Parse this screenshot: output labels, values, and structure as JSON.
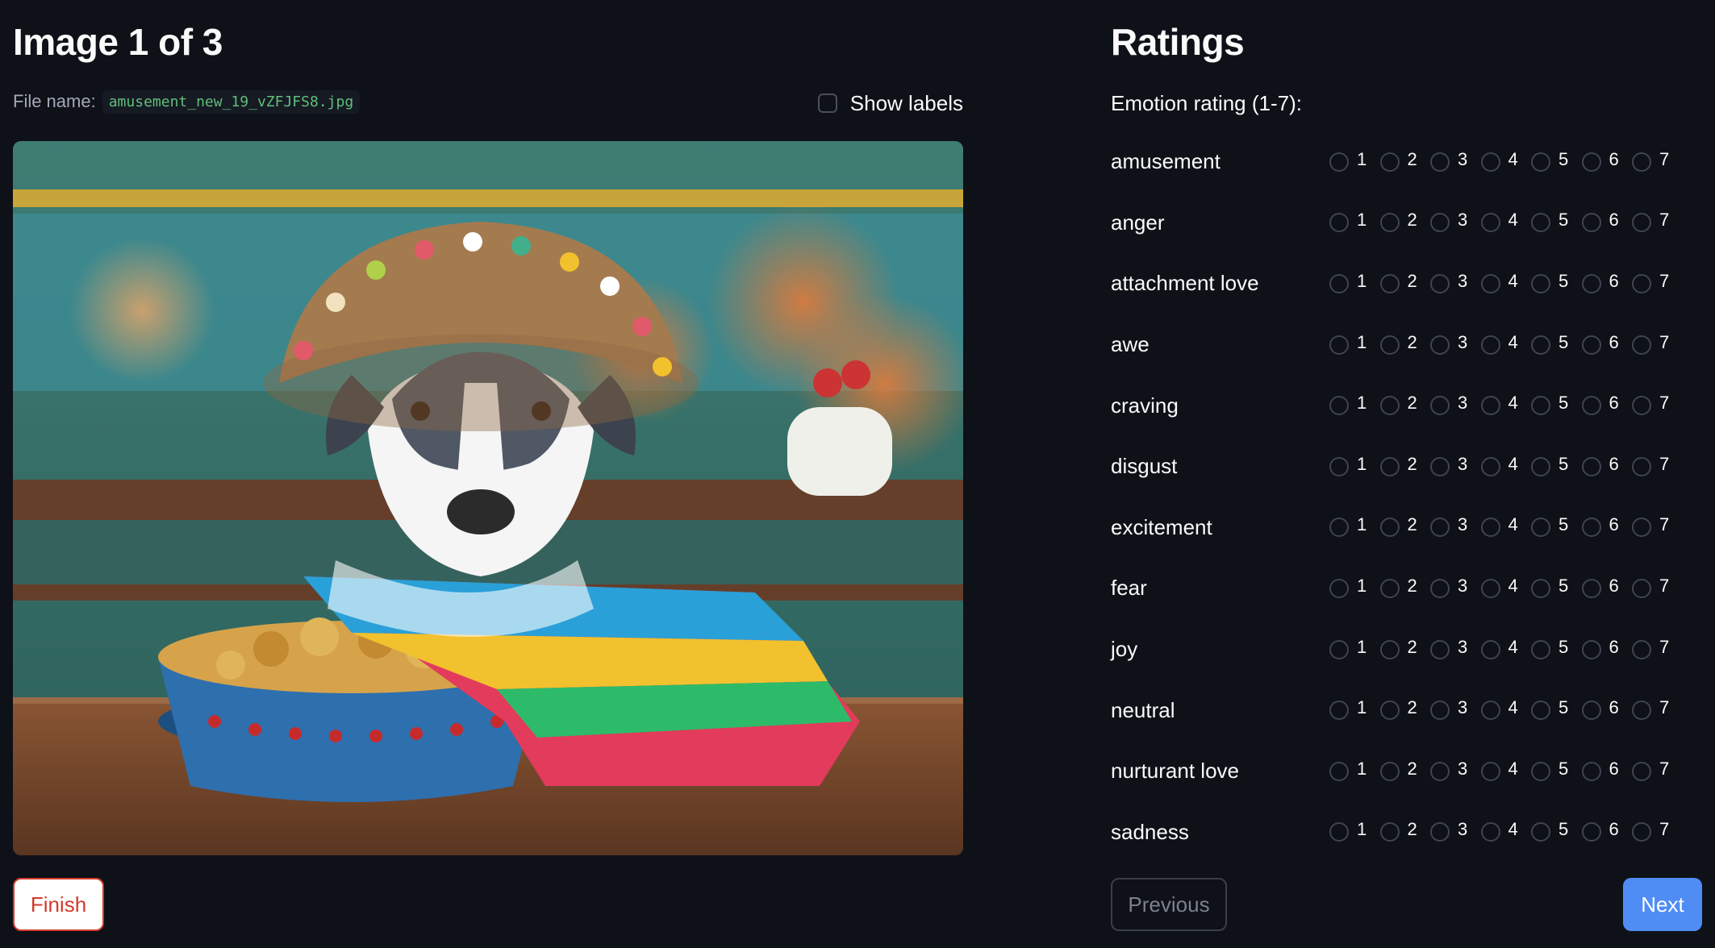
{
  "left": {
    "title": "Image 1 of 3",
    "file_label": "File name:",
    "file_name": "amusement_new_19_vZFJFS8.jpg",
    "show_labels_label": "Show labels",
    "show_labels_checked": false,
    "finish_label": "Finish"
  },
  "right": {
    "title": "Ratings",
    "subtitle": "Emotion rating (1-7):",
    "scale": [
      "1",
      "2",
      "3",
      "4",
      "5",
      "6",
      "7"
    ],
    "emotions": [
      "amusement",
      "anger",
      "attachment love",
      "awe",
      "craving",
      "disgust",
      "excitement",
      "fear",
      "joy",
      "neutral",
      "nurturant love",
      "sadness"
    ],
    "previous_label": "Previous",
    "next_label": "Next"
  },
  "colors": {
    "background": "#0e1117",
    "accent": "#4f8df5",
    "finish_red": "#d33a2c",
    "code_green": "#5fbf7a"
  }
}
